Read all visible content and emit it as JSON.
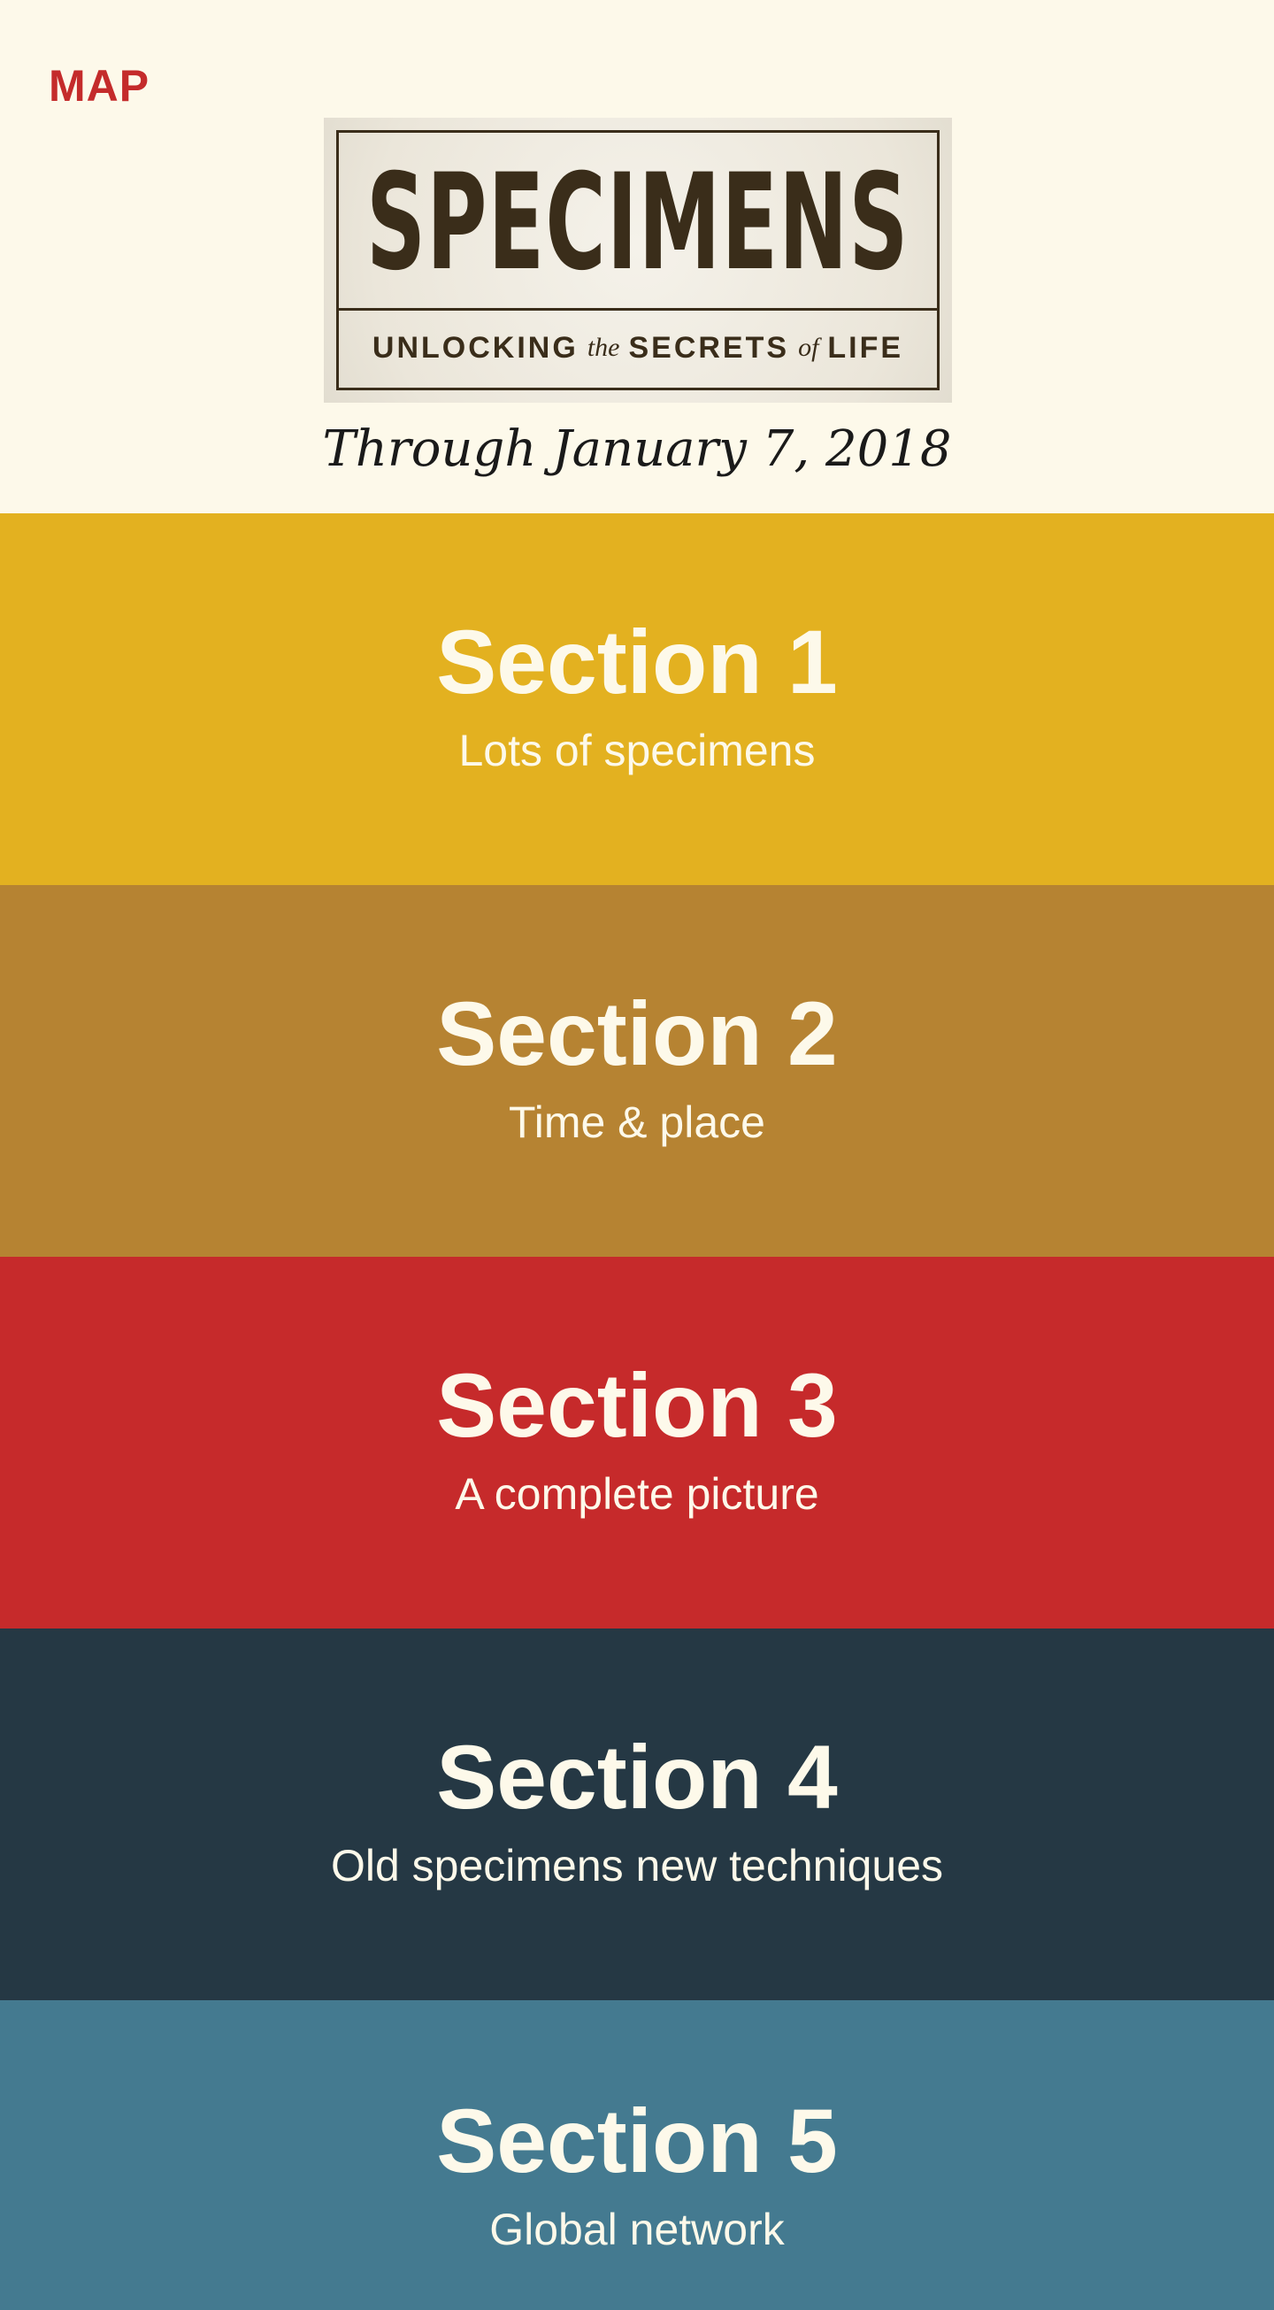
{
  "header": {
    "map_label": "MAP",
    "logo": {
      "title": "SPECIMENS",
      "subtitle_part1": "UNLOCKING",
      "subtitle_part2": "the",
      "subtitle_part3": "SECRETS",
      "subtitle_part4": "of",
      "subtitle_part5": "LIFE"
    },
    "dates": "Through January 7, 2018"
  },
  "sections": [
    {
      "title": "Section 1",
      "subtitle": "Lots of specimens",
      "color": "#e3b120"
    },
    {
      "title": "Section 2",
      "subtitle": "Time & place",
      "color": "#b68332"
    },
    {
      "title": "Section 3",
      "subtitle": "A complete picture",
      "color": "#c62a2b"
    },
    {
      "title": "Section 4",
      "subtitle": "Old specimens new techniques",
      "color": "#253844"
    },
    {
      "title": "Section 5",
      "subtitle": "Global network",
      "color": "#447a90"
    }
  ],
  "colors": {
    "background": "#fdf9ea",
    "accent_red": "#c42b2b",
    "logo_ink": "#3a2d1a",
    "section_text": "#fdf9ea"
  }
}
